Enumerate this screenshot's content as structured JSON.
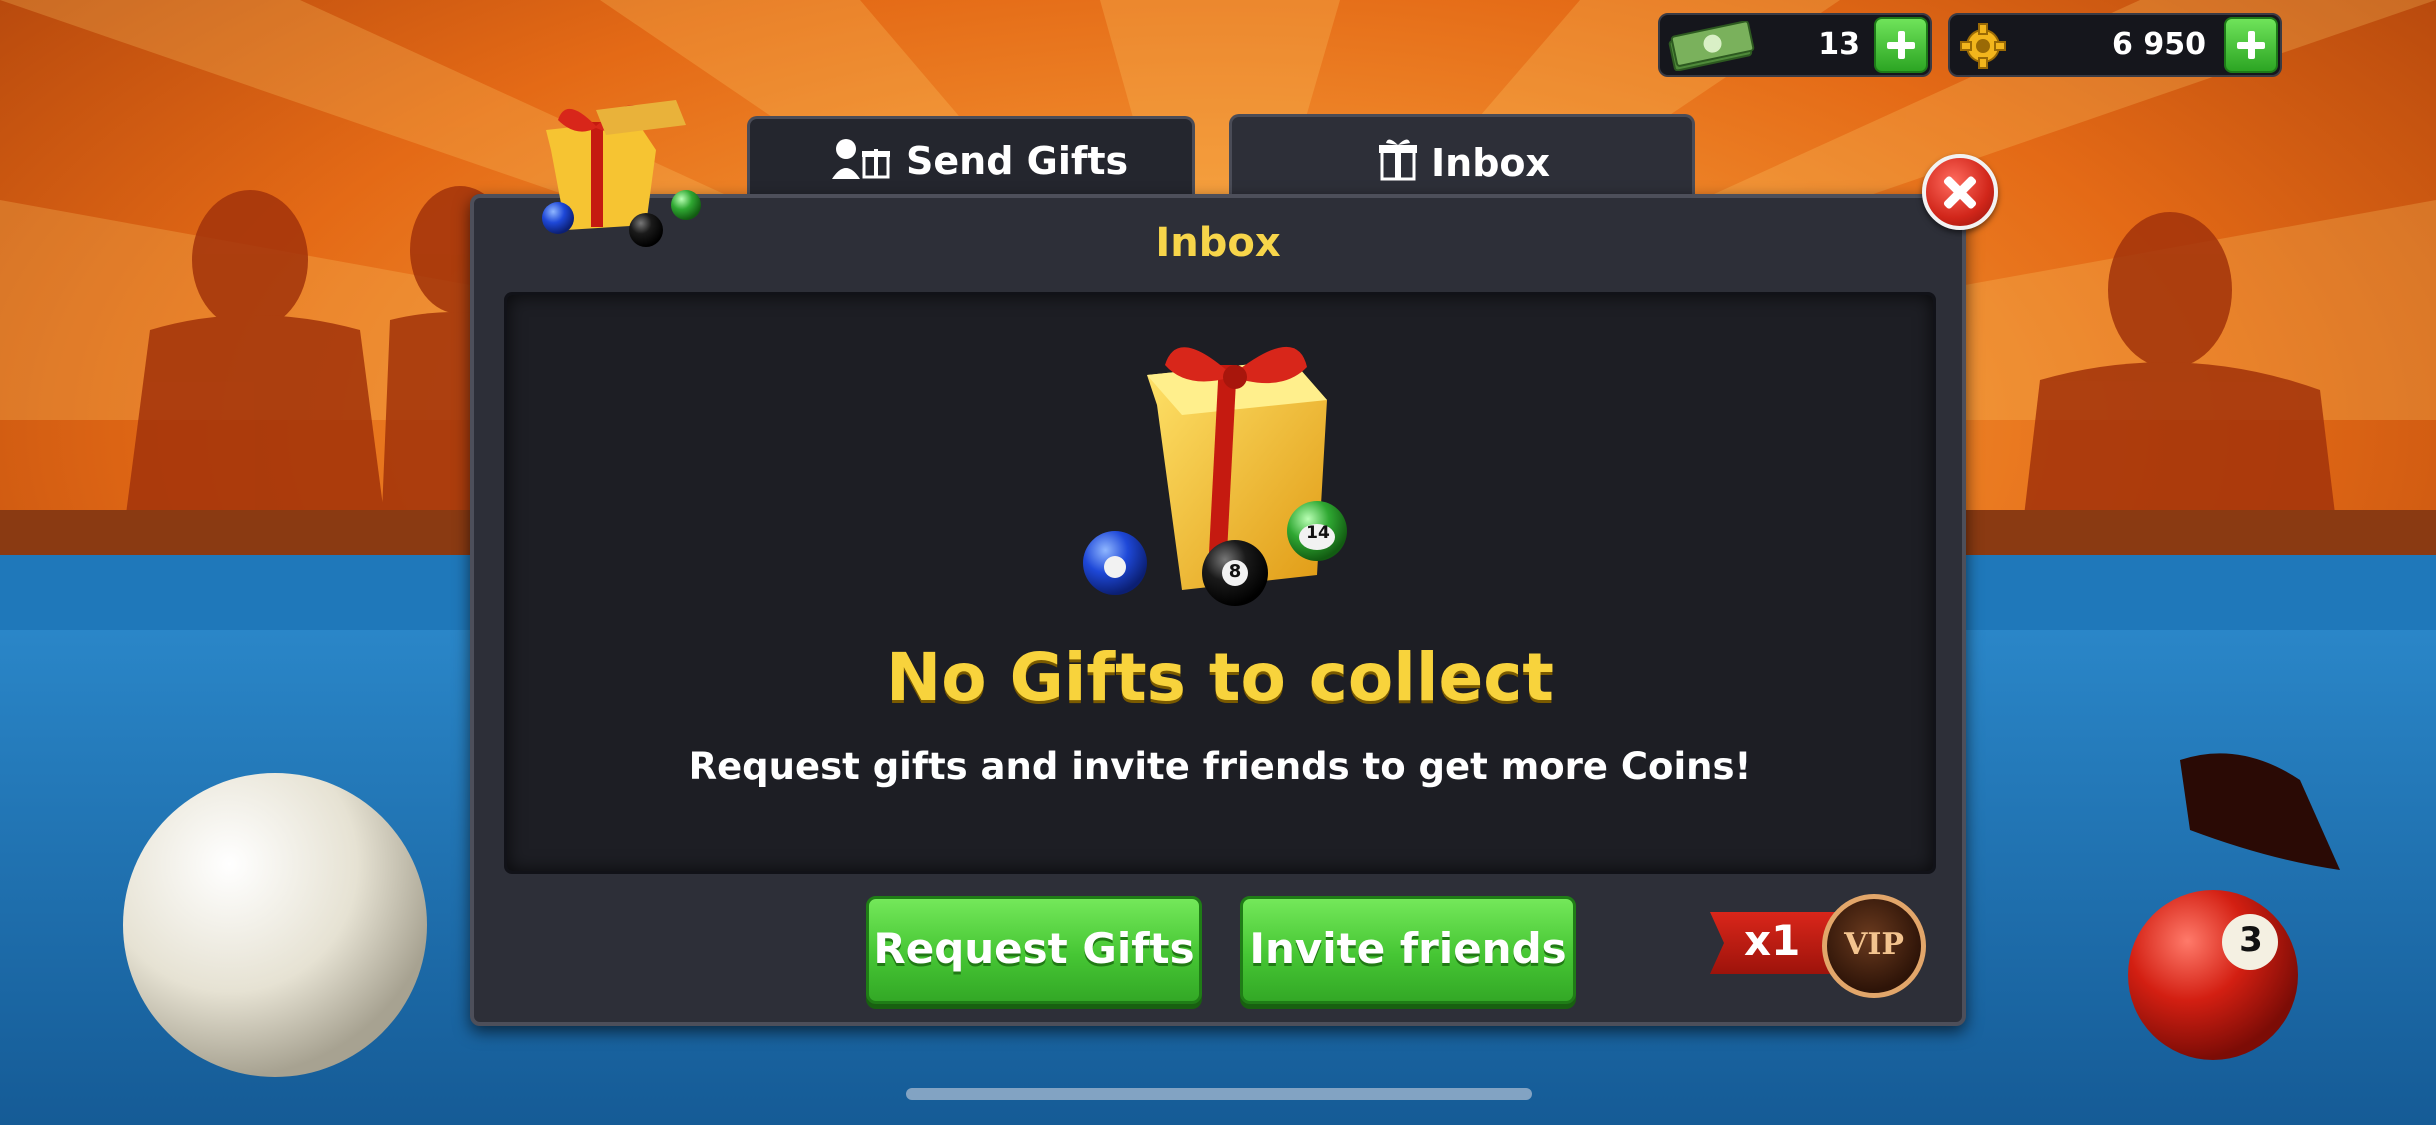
{
  "currency": {
    "cash": {
      "value": "13",
      "icon": "cash-stack-icon"
    },
    "coins": {
      "value": "6 950",
      "icon": "coin-gear-icon"
    }
  },
  "tabs": [
    {
      "label": "Send Gifts",
      "icon": "send-gift-icon",
      "active": false
    },
    {
      "label": "Inbox",
      "icon": "gift-icon",
      "active": true
    }
  ],
  "panel": {
    "title": "Inbox",
    "empty_title": "No Gifts to collect",
    "empty_subtitle": "Request gifts and invite friends to get more Coins!",
    "buttons": {
      "request": "Request Gifts",
      "invite": "Invite friends"
    },
    "vip": {
      "multiplier": "x1",
      "badge": "VIP"
    }
  },
  "balls": {
    "eight": "8",
    "fourteen": "14",
    "three": "3"
  },
  "colors": {
    "accent_yellow": "#f8d33c",
    "button_green": "#46c634",
    "close_red": "#d1261a",
    "panel_bg": "#2d2f38",
    "table_felt": "#1f6fb0"
  }
}
